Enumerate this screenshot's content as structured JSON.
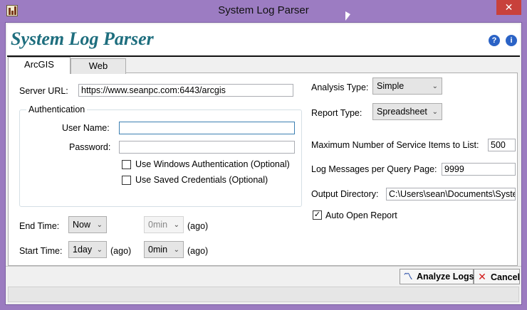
{
  "window": {
    "title": "System Log Parser",
    "close_glyph": "✕",
    "app_icon": "bar-chart-icon"
  },
  "banner": {
    "title": "System Log Parser",
    "help_glyph": "?",
    "info_glyph": "i"
  },
  "tabs": [
    {
      "label": "ArcGIS",
      "active": true
    },
    {
      "label": "Web",
      "active": false
    }
  ],
  "server": {
    "label": "Server URL:",
    "value": "https://www.seanpc.com:6443/arcgis"
  },
  "auth": {
    "group_title": "Authentication",
    "username_label": "User Name:",
    "username_value": "",
    "password_label": "Password:",
    "password_value": "",
    "windows_auth_label": "Use Windows Authentication (Optional)",
    "windows_auth_checked": false,
    "saved_creds_label": "Use Saved Credentials (Optional)",
    "saved_creds_checked": false
  },
  "time": {
    "end_label": "End Time:",
    "end_value": "Now",
    "end_offset": "0min",
    "end_ago": "(ago)",
    "start_label": "Start Time:",
    "start_value": "1day",
    "start_ago": "(ago)",
    "start_offset": "0min",
    "start_offset_ago": "(ago)"
  },
  "analysis": {
    "type_label": "Analysis Type:",
    "type_value": "Simple",
    "report_label": "Report Type:",
    "report_value": "Spreadsheet",
    "max_items_label": "Maximum Number of Service Items to List:",
    "max_items_value": "500",
    "log_per_page_label": "Log Messages per Query Page:",
    "log_per_page_value": "9999",
    "output_dir_label": "Output Directory:",
    "output_dir_value": "C:\\Users\\sean\\Documents\\System",
    "auto_open_label": "Auto Open Report",
    "auto_open_checked": true,
    "check_glyph": "✓"
  },
  "buttons": {
    "analyze_label": "Analyze Logs",
    "cancel_label": "Cancel",
    "analyze_icon": "chart-line-icon",
    "cancel_icon": "close-icon"
  },
  "dropdown_arrow": "⌄"
}
